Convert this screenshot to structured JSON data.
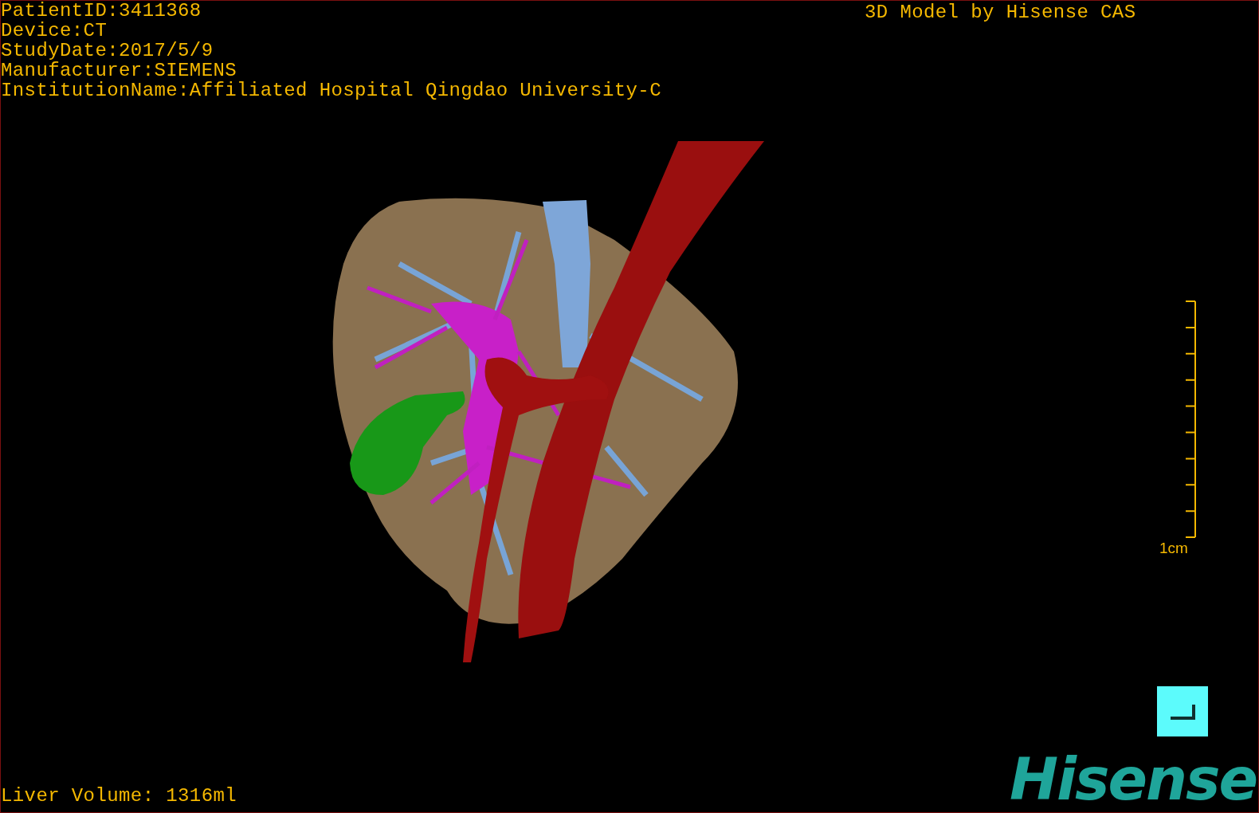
{
  "patient_info": [
    "PatientID:3411368",
    "Device:CT",
    "StudyDate:2017/5/9",
    "Manufacturer:SIEMENS",
    "InstitutionName:Affiliated Hospital Qingdao University-C"
  ],
  "model_credit": "3D Model by Hisense CAS",
  "scale_bar": {
    "label": "1cm"
  },
  "liver_volume": "Liver Volume: 1316ml",
  "logo": "Hisense"
}
